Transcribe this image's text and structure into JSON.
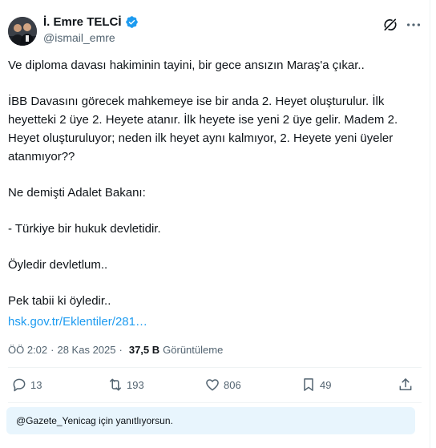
{
  "author": {
    "name": "İ. Emre TELCİ",
    "handle": "@ismail_emre",
    "verified": true,
    "avatar_icon": "avatar-photo"
  },
  "header_icons": [
    "grok-icon",
    "more-options-icon"
  ],
  "tweet": {
    "paragraphs": [
      "Ve diploma davası hakiminin tayini, bir gece ansızın Maraş'a çıkar..",
      "İBB Davasını görecek mahkemeye ise bir anda 2. Heyet oluşturulur. İlk heyetteki 2 üye 2. Heyete atanır. İlk heyete ise yeni 2 üye gelir. Madem 2. Heyet oluşturuluyor; neden ilk heyet aynı kalmıyor, 2. Heyete yeni üyeler atanmıyor??",
      "Ne demişti Adalet Bakanı:",
      "- Türkiye bir hukuk devletidir.",
      "Öyledir devletlum..",
      "Pek tabii ki öyledir.."
    ],
    "link": "hsk.gov.tr/Eklentiler/281…"
  },
  "meta": {
    "time": "ÖÖ 2:02",
    "date": "28 Kas 2025",
    "views": "37,5 B",
    "views_label": "Görüntüleme"
  },
  "actions": {
    "replies": "13",
    "reposts": "193",
    "likes": "806",
    "bookmarks": "49"
  },
  "reply_banner": "@Gazete_Yenicag için yanıtlıyorsun.",
  "colors": {
    "accent": "#1d9bf0",
    "secondary_text": "#536471",
    "banner_bg": "#e8f5fd"
  }
}
